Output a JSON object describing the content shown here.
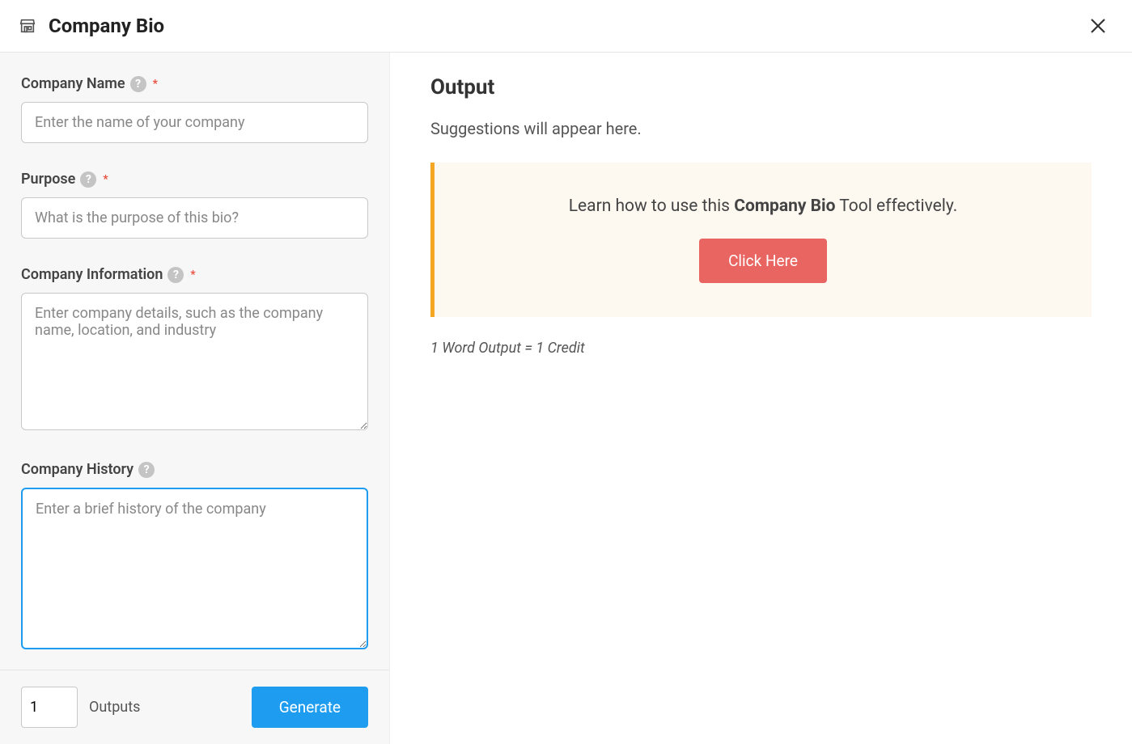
{
  "header": {
    "title": "Company Bio"
  },
  "form": {
    "company_name": {
      "label": "Company Name",
      "required": true,
      "placeholder": "Enter the name of your company",
      "value": ""
    },
    "purpose": {
      "label": "Purpose",
      "required": true,
      "placeholder": "What is the purpose of this bio?",
      "value": ""
    },
    "company_information": {
      "label": "Company Information",
      "required": true,
      "placeholder": "Enter company details, such as the company name, location, and industry",
      "value": ""
    },
    "company_history": {
      "label": "Company History",
      "required": false,
      "placeholder": "Enter a brief history of the company",
      "value": ""
    }
  },
  "footer": {
    "outputs_value": "1",
    "outputs_label": "Outputs",
    "generate_label": "Generate"
  },
  "output": {
    "title": "Output",
    "suggestions_text": "Suggestions will appear here.",
    "callout_prefix": "Learn how to use this ",
    "callout_bold": "Company Bio",
    "callout_suffix": " Tool effectively.",
    "click_here_label": "Click Here",
    "credit_note": "1 Word Output = 1 Credit"
  }
}
